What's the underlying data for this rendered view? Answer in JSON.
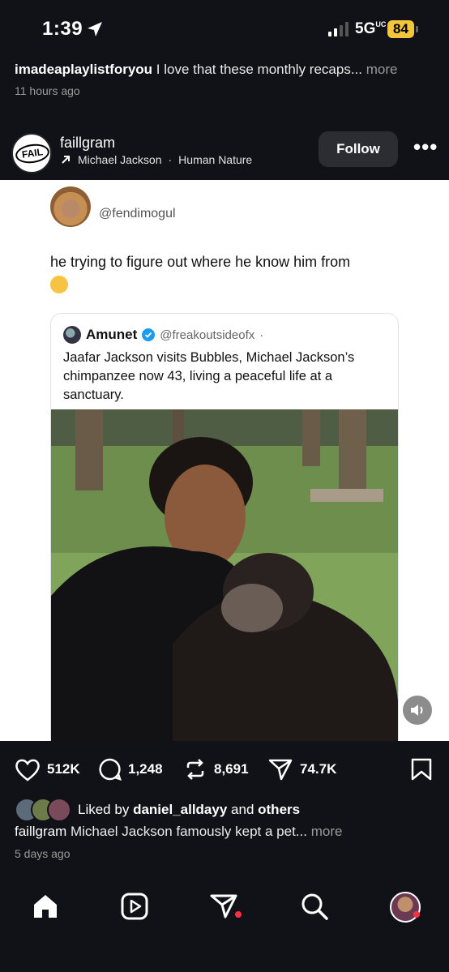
{
  "status_bar": {
    "time": "1:39",
    "network": "5G",
    "network_suffix": "UC",
    "battery": "84"
  },
  "previous_post": {
    "username": "imadeaplaylistforyou",
    "caption": "I love that these monthly recaps...",
    "more_label": "more",
    "time_ago": "11 hours ago"
  },
  "post": {
    "username": "faillgram",
    "avatar_text": "FAIL",
    "audio_artist": "Michael Jackson",
    "audio_separator": "·",
    "audio_track": "Human Nature",
    "follow_label": "Follow",
    "tweet": {
      "handle": "@fendimogul",
      "text": "he trying to figure out where he know him from",
      "quoted": {
        "name": "Amunet",
        "handle": "@freakoutsideofx",
        "separator": "·",
        "text": "Jaafar Jackson visits Bubbles, Michael Jackson’s chimpanzee now 43, living a peaceful life at a sanctuary."
      }
    },
    "likes": "512K",
    "comments": "1,248",
    "reposts": "8,691",
    "shares": "74.7K",
    "liked_by_prefix": "Liked by",
    "liked_by_user": "daniel_alldayy",
    "liked_by_and": "and",
    "liked_by_others": "others",
    "caption": "Michael Jackson famously kept a pet...",
    "more_label": "more",
    "time_ago": "5 days ago"
  },
  "colors": {
    "accent_red": "#ff3040",
    "battery": "#f3c53b",
    "bg": "#111217"
  }
}
